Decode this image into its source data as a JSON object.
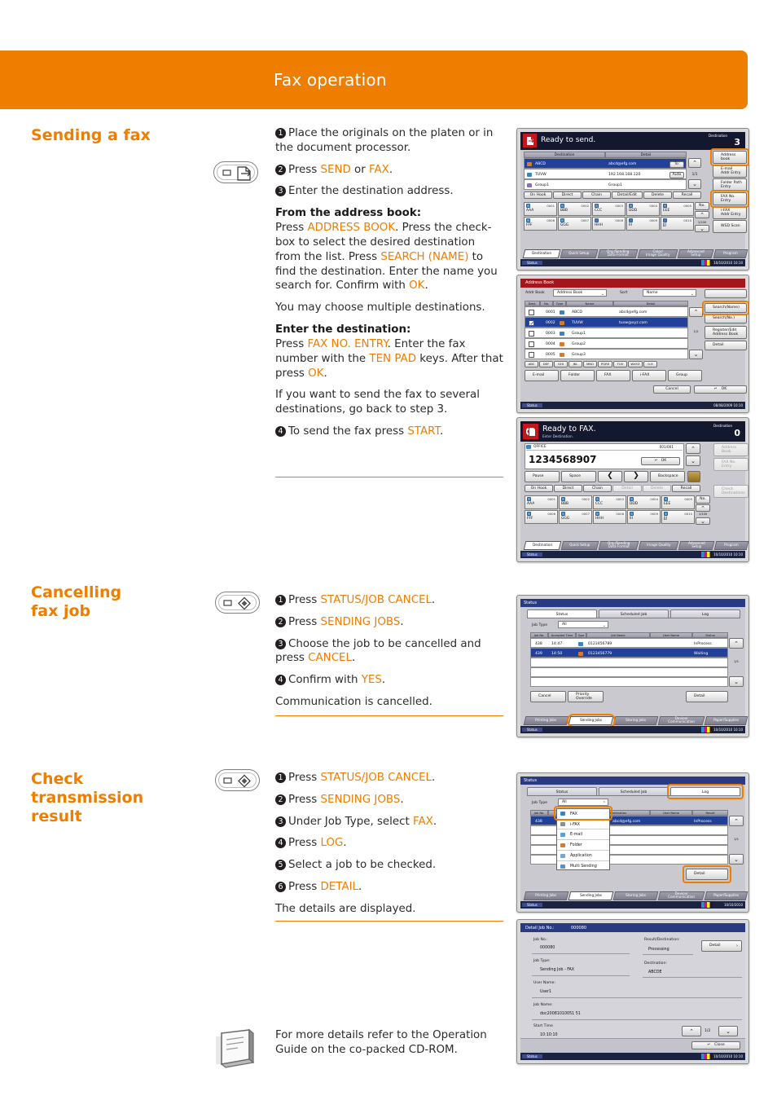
{
  "header": {
    "title": "Fax operation",
    "accent": "#ee7d00"
  },
  "sections": [
    {
      "heading": "Sending a fax",
      "key_icon": "send-key-icon",
      "steps": [
        {
          "n": "1",
          "parts": [
            {
              "t": "Place the originals on the platen or in the document processor."
            }
          ]
        },
        {
          "n": "2",
          "parts": [
            {
              "t": "Press "
            },
            {
              "t": "SEND",
              "k": true
            },
            {
              "t": " or "
            },
            {
              "t": "FAX",
              "k": true
            },
            {
              "t": "."
            }
          ]
        },
        {
          "n": "3",
          "parts": [
            {
              "t": "Enter the destination address."
            }
          ]
        }
      ],
      "sub1_title": "From the address book:",
      "sub1_body": [
        {
          "t": "Press "
        },
        {
          "t": "ADDRESS BOOK",
          "k": true
        },
        {
          "t": ". Press the check-box to select the desired destination from the list. Press "
        },
        {
          "t": "SEARCH (NAME)",
          "k": true
        },
        {
          "t": " to find the destination. Enter the name you search for. Confirm with "
        },
        {
          "t": "OK",
          "k": true
        },
        {
          "t": "."
        }
      ],
      "note1": "You may choose multiple destinations.",
      "sub2_title": "Enter the destination:",
      "sub2_body": [
        {
          "t": "Press "
        },
        {
          "t": "FAX NO. ENTRY",
          "k": true
        },
        {
          "t": ". Enter the fax number with the "
        },
        {
          "t": "TEN PAD",
          "k": true
        },
        {
          "t": " keys. After that press "
        },
        {
          "t": "OK",
          "k": true
        },
        {
          "t": "."
        }
      ],
      "note2": "If you want to send the fax to several destinations, go back to step 3.",
      "last_step": {
        "n": "4",
        "parts": [
          {
            "t": "To send the fax press "
          },
          {
            "t": "START",
            "k": true
          },
          {
            "t": "."
          }
        ]
      }
    },
    {
      "heading": "Cancelling\nfax job",
      "key_icon": "status-job-cancel-key-icon",
      "steps": [
        {
          "n": "1",
          "parts": [
            {
              "t": "Press "
            },
            {
              "t": "STATUS/JOB CANCEL",
              "k": true
            },
            {
              "t": "."
            }
          ]
        },
        {
          "n": "2",
          "parts": [
            {
              "t": "Press "
            },
            {
              "t": "SENDING JOBS",
              "k": true
            },
            {
              "t": "."
            }
          ]
        },
        {
          "n": "3",
          "parts": [
            {
              "t": "Choose the job to be cancelled and press "
            },
            {
              "t": "CANCEL",
              "k": true
            },
            {
              "t": "."
            }
          ]
        },
        {
          "n": "4",
          "parts": [
            {
              "t": "Confirm with "
            },
            {
              "t": "YES",
              "k": true
            },
            {
              "t": "."
            }
          ]
        }
      ],
      "note1": "Communication is cancelled."
    },
    {
      "heading": "Check\ntransmission\nresult",
      "key_icon": "status-job-cancel-key-icon",
      "steps": [
        {
          "n": "1",
          "parts": [
            {
              "t": "Press "
            },
            {
              "t": "STATUS/JOB CANCEL",
              "k": true
            },
            {
              "t": "."
            }
          ]
        },
        {
          "n": "2",
          "parts": [
            {
              "t": "Press "
            },
            {
              "t": "SENDING JOBS",
              "k": true
            },
            {
              "t": "."
            }
          ]
        },
        {
          "n": "3",
          "parts": [
            {
              "t": "Under Job Type, select "
            },
            {
              "t": "FAX",
              "k": true
            },
            {
              "t": "."
            }
          ]
        },
        {
          "n": "4",
          "parts": [
            {
              "t": "Press "
            },
            {
              "t": "LOG",
              "k": true
            },
            {
              "t": "."
            }
          ]
        },
        {
          "n": "5",
          "parts": [
            {
              "t": "Select a job to be checked."
            }
          ]
        },
        {
          "n": "6",
          "parts": [
            {
              "t": "Press "
            },
            {
              "t": "DETAIL",
              "k": true
            },
            {
              "t": "."
            }
          ]
        }
      ],
      "note1": "The details are displayed."
    }
  ],
  "footer": {
    "icon": "manual-book-icon",
    "text": "For more details refer to the Operation Guide on the co-packed CD-ROM."
  },
  "panel_send": {
    "title": "Ready to send.",
    "dest_label": "Destination",
    "dest_count": "3",
    "col_dest": "Destination",
    "col_detail": "Detail",
    "rows": [
      {
        "name": "ABCD",
        "detail": "abcd@efg.com",
        "tag": "To:",
        "selected": true
      },
      {
        "name": "TUVW",
        "detail": "192.168.168.120",
        "tag": "Auto",
        "selected": false
      },
      {
        "name": "Group1",
        "detail": "Group1",
        "tag": "",
        "selected": false
      }
    ],
    "page": "1/1",
    "action_buttons": [
      "On Hook",
      "Direct",
      "Chain",
      "Detail/Edit",
      "Delete",
      "Recall"
    ],
    "speed_dials": [
      {
        "no": "0001",
        "nm": "AAA"
      },
      {
        "no": "0002",
        "nm": "BBB"
      },
      {
        "no": "0003",
        "nm": "CCC"
      },
      {
        "no": "0004",
        "nm": "DDD"
      },
      {
        "no": "0005",
        "nm": "EEE"
      },
      {
        "no": "0006",
        "nm": "FFF"
      },
      {
        "no": "0007",
        "nm": "GGG"
      },
      {
        "no": "0008",
        "nm": "HHH"
      },
      {
        "no": "0009",
        "nm": "III"
      },
      {
        "no": "0010",
        "nm": "JJJ"
      }
    ],
    "no_button": "No.",
    "speed_page": "1/100",
    "side_buttons": [
      {
        "label": "Address\nbook",
        "highlight": true
      },
      {
        "label": "E-mail\nAddr Entry",
        "highlight": false
      },
      {
        "label": "Folder Path\nEntry",
        "highlight": false
      },
      {
        "label": "FAX No.\nEntry",
        "highlight": true
      },
      {
        "label": "i-FAX\nAddr Entry",
        "highlight": false
      },
      {
        "label": "WSD Scan",
        "highlight": false
      }
    ],
    "tabs": [
      "Destination",
      "Quick Setup",
      "Org./Sending\nData Format",
      "Color/\nImage Quality",
      "Advanced\nSetup",
      "Program"
    ],
    "status_label": "Status",
    "datetime": "10/10/2010  10:10"
  },
  "panel_addrbook": {
    "title": "Address Book",
    "addr_book_label": "Addr Book",
    "addr_book_value": "Address Book",
    "sort_label": "Sort",
    "sort_value": "Name",
    "headers": [
      "Dest.",
      "No.",
      "Type",
      "Name",
      "Detail"
    ],
    "rows": [
      {
        "no": "0001",
        "name": "ABCD",
        "detail": "abcd@efg.com",
        "checked": false,
        "selected": false
      },
      {
        "no": "0002",
        "name": "TUVW",
        "detail": "tuvw@xyz.com",
        "checked": true,
        "selected": true
      },
      {
        "no": "0003",
        "name": "Group1",
        "detail": "",
        "checked": false,
        "selected": false
      },
      {
        "no": "0004",
        "name": "Group2",
        "detail": "",
        "checked": false,
        "selected": false
      },
      {
        "no": "0005",
        "name": "Group3",
        "detail": "",
        "checked": false,
        "selected": false
      }
    ],
    "page": "1/2",
    "alpha_keys": [
      "ABC",
      "DEF",
      "GHI",
      "JKL",
      "MNO",
      "PQRS",
      "TUV",
      "WXYZ",
      "0-9"
    ],
    "type_buttons": [
      "E-mail",
      "Folder",
      "FAX",
      "i-FAX",
      "Group"
    ],
    "side_buttons": [
      {
        "label": "Search(Name)",
        "highlight": true
      },
      {
        "label": "Search(No.)",
        "highlight": false
      },
      {
        "label": "Register/Edit\nAddress Book",
        "highlight": false
      },
      {
        "label": "Detail",
        "highlight": false
      }
    ],
    "cancel": "Cancel",
    "ok": "OK",
    "status_label": "Status",
    "datetime": "08/08/2009  10:10"
  },
  "panel_fax": {
    "title": "Ready to FAX.",
    "subtitle": "Enter Destination.",
    "dest_label": "Destination",
    "dest_count": "0",
    "office_label": "OFFICE",
    "office_count": "001/001",
    "number": "1234568907",
    "ok": "OK",
    "edit_buttons": [
      "Pause",
      "Space",
      "❮",
      "❯",
      "Backspace"
    ],
    "action_buttons": [
      "On Hook",
      "Direct",
      "Chain",
      "Detail",
      "Delete",
      "Recall"
    ],
    "disabled_actions": [
      "Detail",
      "Delete"
    ],
    "speed_dials": [
      {
        "no": "0001",
        "nm": "AAA"
      },
      {
        "no": "0002",
        "nm": "BBB"
      },
      {
        "no": "0003",
        "nm": "CCC"
      },
      {
        "no": "0004",
        "nm": "DDD"
      },
      {
        "no": "0005",
        "nm": "EEE"
      },
      {
        "no": "0006",
        "nm": "FFF"
      },
      {
        "no": "0007",
        "nm": "GGG"
      },
      {
        "no": "0008",
        "nm": "HHH"
      },
      {
        "no": "0009",
        "nm": "III"
      },
      {
        "no": "0010",
        "nm": "JJJ"
      }
    ],
    "no_button": "No.",
    "speed_page": "1/100",
    "side_buttons": [
      "Address\nBook",
      "FAX No.\nEntry",
      "Check\nDestinations"
    ],
    "tabs": [
      "Destination",
      "Quick Setup",
      "Org./Sending\nData Format",
      "Image Quality",
      "Advanced\nSetup",
      "Program"
    ],
    "status_label": "Status",
    "datetime": "10/10/2010  10:10"
  },
  "panel_status": {
    "title": "Status",
    "top_tabs": [
      "Status",
      "Scheduled Job",
      "Log"
    ],
    "active_top_tab": "Status",
    "jobtype_label": "Job Type",
    "jobtype_value": "All",
    "headers": [
      "Job No.",
      "Accepted Time",
      "Type",
      "Job Name",
      "User Name",
      "Status"
    ],
    "rows": [
      {
        "no": "438",
        "time": "14:47",
        "job": "0123456789",
        "user": "",
        "status": "InProcess",
        "selected": false
      },
      {
        "no": "439",
        "time": "14:50",
        "job": "0123456779",
        "user": "",
        "status": "Waiting",
        "selected": true
      }
    ],
    "page": "1/1",
    "buttons": [
      "Cancel",
      "Priority\nOverride",
      "Detail"
    ],
    "bottom_tabs": [
      "Printing Jobs",
      "Sending Jobs",
      "Storing Jobs",
      "Device/\nCommunication",
      "Paper/Supplies"
    ],
    "active_bottom_tab": "Sending Jobs",
    "status_label": "Status",
    "datetime": "10/10/2010  10:10"
  },
  "panel_log": {
    "title": "Status",
    "top_tabs": [
      "Status",
      "Scheduled Job",
      "Log"
    ],
    "highlight_top_tab": "Log",
    "jobtype_label": "Job Type",
    "jobtype_value": "All",
    "headers": [
      "Job No.",
      "",
      "",
      "Destination",
      "User Name",
      "Result"
    ],
    "rows": [
      {
        "no": "438",
        "dest": "abcd@efg.com",
        "user": "",
        "result": "InProcess",
        "selected": true
      }
    ],
    "page": "1/1",
    "dropdown_items": [
      "FAX",
      "i-FAX",
      "E-mail",
      "Folder",
      "Application",
      "Multi Sending"
    ],
    "dropdown_highlight": "FAX",
    "detail_button": "Detail",
    "bottom_tabs": [
      "Printing Jobs",
      "Sending Jobs",
      "Storing Jobs",
      "Device/\nCommunication",
      "Paper/Supplies"
    ],
    "active_bottom_tab": "Sending Jobs",
    "status_label": "Status",
    "datetime": "10/10/2010"
  },
  "panel_detail": {
    "title_label": "Detail Job No.:",
    "title_value": "000080",
    "fields": [
      {
        "label": "Job No.:",
        "value": "000080"
      },
      {
        "label": "Job Type:",
        "value": "Sending Job - FAX"
      },
      {
        "label": "User Name:",
        "value": "User1"
      },
      {
        "label": "Job Name:",
        "value": "doc20081010051 51"
      },
      {
        "label": "Start Time",
        "value": "10:10:10"
      }
    ],
    "right_fields": [
      {
        "label": "Result/Destination:",
        "value": "Processing"
      },
      {
        "label": "Destination:",
        "value": "ABCDE"
      }
    ],
    "detail_button": "Detail",
    "page": "1/2",
    "close": "Close",
    "status_label": "Status",
    "datetime": "10/10/2010  10:10"
  }
}
